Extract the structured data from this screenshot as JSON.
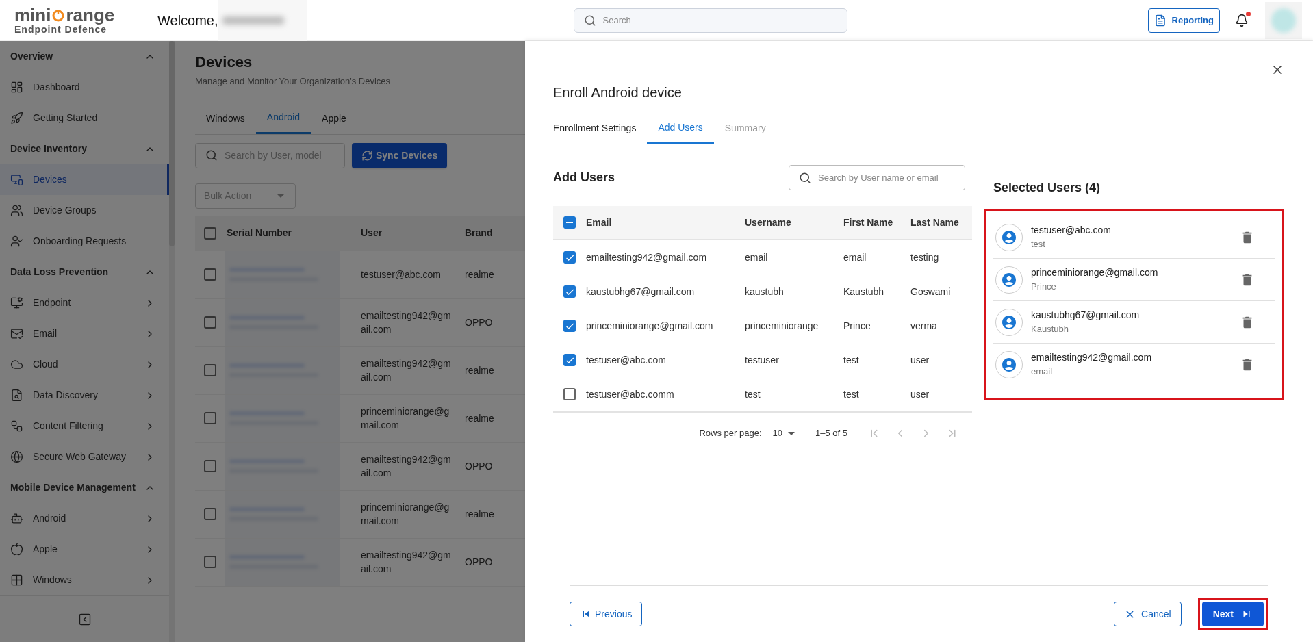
{
  "header": {
    "logo": {
      "before": "mini",
      "after": "range",
      "tagline": "Endpoint Defence"
    },
    "welcome": "Welcome,",
    "search": {
      "placeholder": "Search"
    },
    "reporting": "Reporting",
    "notifications": {
      "unread": true
    }
  },
  "sidebar": {
    "sections": [
      {
        "title": "Overview",
        "expanded": true,
        "items": [
          {
            "label": "Dashboard",
            "selected": false,
            "expandable": false
          },
          {
            "label": "Getting Started",
            "selected": false,
            "expandable": false
          }
        ]
      },
      {
        "title": "Device Inventory",
        "expanded": true,
        "items": [
          {
            "label": "Devices",
            "selected": true,
            "expandable": false
          },
          {
            "label": "Device Groups",
            "selected": false,
            "expandable": false
          },
          {
            "label": "Onboarding Requests",
            "selected": false,
            "expandable": false
          }
        ]
      },
      {
        "title": "Data Loss Prevention",
        "expanded": true,
        "items": [
          {
            "label": "Endpoint",
            "selected": false,
            "expandable": true
          },
          {
            "label": "Email",
            "selected": false,
            "expandable": true
          },
          {
            "label": "Cloud",
            "selected": false,
            "expandable": true
          },
          {
            "label": "Data Discovery",
            "selected": false,
            "expandable": true
          },
          {
            "label": "Content Filtering",
            "selected": false,
            "expandable": true
          },
          {
            "label": "Secure Web Gateway",
            "selected": false,
            "expandable": true
          }
        ]
      },
      {
        "title": "Mobile Device Management",
        "expanded": true,
        "items": [
          {
            "label": "Android",
            "selected": false,
            "expandable": true
          },
          {
            "label": "Apple",
            "selected": false,
            "expandable": true
          },
          {
            "label": "Windows",
            "selected": false,
            "expandable": true
          }
        ]
      }
    ]
  },
  "page": {
    "title": "Devices",
    "subtitle": "Manage and Monitor Your Organization's Devices",
    "tabs": [
      {
        "label": "Windows",
        "selected": false
      },
      {
        "label": "Android",
        "selected": true
      },
      {
        "label": "Apple",
        "selected": false
      }
    ],
    "search": {
      "placeholder": "Search by User, model"
    },
    "sync_button": "Sync Devices",
    "bulk_action": {
      "label": "Bulk Action",
      "disabled": true
    },
    "table": {
      "select_all": false,
      "columns": [
        "Serial Number",
        "User",
        "Brand"
      ],
      "rows": [
        {
          "checked": false,
          "user": "testuser@abc.com",
          "brand": "realme"
        },
        {
          "checked": false,
          "user": "emailtesting942@gmail.com",
          "brand": "OPPO"
        },
        {
          "checked": false,
          "user": "emailtesting942@gmail.com",
          "brand": "realme"
        },
        {
          "checked": false,
          "user": "princeminiorange@gmail.com",
          "brand": "realme"
        },
        {
          "checked": false,
          "user": "emailtesting942@gmail.com",
          "brand": "OPPO"
        },
        {
          "checked": false,
          "user": "princeminiorange@gmail.com",
          "brand": "realme"
        },
        {
          "checked": false,
          "user": "emailtesting942@gmail.com",
          "brand": "OPPO"
        }
      ]
    }
  },
  "dialog": {
    "title": "Enroll Android device",
    "steps": [
      {
        "label": "Enrollment Settings",
        "selected": false,
        "disabled": false
      },
      {
        "label": "Add Users",
        "selected": true,
        "disabled": false
      },
      {
        "label": "Summary",
        "selected": false,
        "disabled": true
      }
    ],
    "add_users": {
      "title": "Add Users",
      "search": {
        "placeholder": "Search by User name or email"
      },
      "select_all": {
        "indeterminate": true
      },
      "columns": [
        "Email",
        "Username",
        "First Name",
        "Last Name"
      ],
      "rows": [
        {
          "checked": true,
          "email": "emailtesting942@gmail.com",
          "username": "email",
          "first_name": "email",
          "last_name": "testing"
        },
        {
          "checked": true,
          "email": "kaustubhg67@gmail.com",
          "username": "kaustubh",
          "first_name": "Kaustubh",
          "last_name": "Goswami"
        },
        {
          "checked": true,
          "email": "princeminiorange@gmail.com",
          "username": "princeminiorange",
          "first_name": "Prince",
          "last_name": "verma"
        },
        {
          "checked": true,
          "email": "testuser@abc.com",
          "username": "testuser",
          "first_name": "test",
          "last_name": "user"
        },
        {
          "checked": false,
          "email": "testuser@abc.comm",
          "username": "test",
          "first_name": "test",
          "last_name": "user"
        }
      ],
      "pagination": {
        "rows_label": "Rows per page:",
        "rows_value": "10",
        "range": "1–5 of 5",
        "nav": [
          {
            "kind": "first",
            "disabled": true
          },
          {
            "kind": "prev",
            "disabled": true
          },
          {
            "kind": "next",
            "disabled": true
          },
          {
            "kind": "last",
            "disabled": true
          }
        ]
      }
    },
    "selected_users": {
      "title": "Selected Users (4)",
      "highlighted": true,
      "items": [
        {
          "email": "testuser@abc.com",
          "name": "test"
        },
        {
          "email": "princeminiorange@gmail.com",
          "name": "Prince"
        },
        {
          "email": "kaustubhg67@gmail.com",
          "name": "Kaustubh"
        },
        {
          "email": "emailtesting942@gmail.com",
          "name": "email"
        }
      ]
    },
    "footer": {
      "previous": "Previous",
      "cancel": "Cancel",
      "next": {
        "label": "Next",
        "highlighted": true
      }
    }
  }
}
